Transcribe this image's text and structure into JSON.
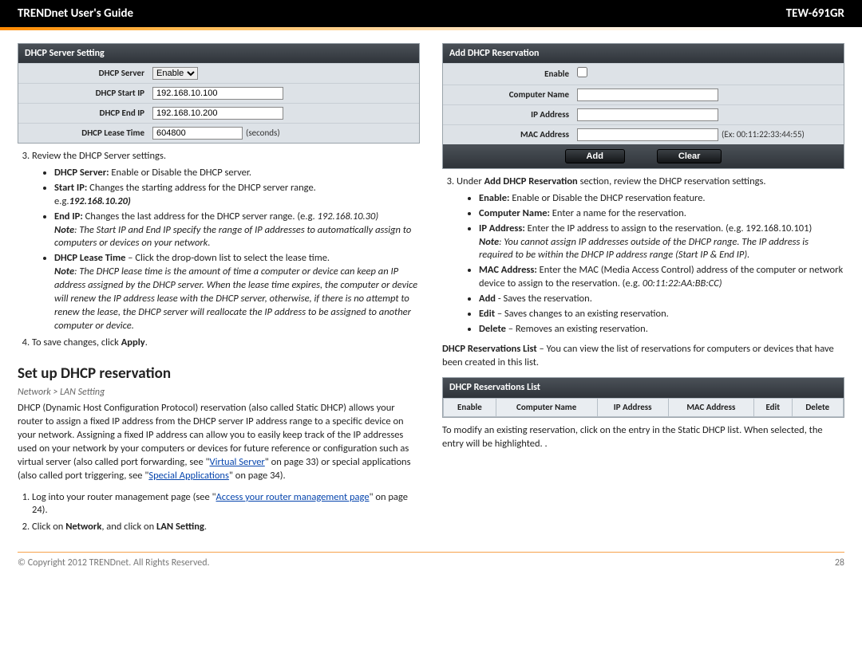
{
  "header": {
    "left": "TRENDnet User's Guide",
    "right": "TEW-691GR"
  },
  "dhcpServerPanel": {
    "title": "DHCP Server Setting",
    "rows": {
      "serverLabel": "DHCP Server",
      "serverValue": "Enable",
      "startLabel": "DHCP Start IP",
      "startValue": "192.168.10.100",
      "endLabel": "DHCP End IP",
      "endValue": "192.168.10.200",
      "leaseLabel": "DHCP Lease Time",
      "leaseValue": "604800",
      "leaseSuffix": "(seconds)"
    }
  },
  "reviewIntro": "Review the DHCP Server settings.",
  "reviewBullets": {
    "b1_label": "DHCP Server:",
    "b1_text": " Enable or Disable the DHCP server.",
    "b2_label": "Start IP:",
    "b2_text": " Changes the starting address for the DHCP server range.",
    "b2_eg_prefix": "e.g.",
    "b2_eg_value": "192.168.10.20)",
    "b3_label": "End IP:",
    "b3_text": " Changes the last address for the DHCP server range. (e.g. ",
    "b3_eg": "192.168.10.30)",
    "b3_note_label": "Note",
    "b3_note": ": The Start IP and End IP specify the range of IP addresses to automatically assign to computers or devices on your network.",
    "b4_label": "DHCP Lease Time",
    "b4_text": " – Click the drop-down list to select the lease time.",
    "b4_note_label": "Note",
    "b4_note": ": The DHCP lease time is the amount of time a computer or device can keep an IP address assigned by the DHCP server. When the lease time expires, the computer or device will renew the IP address lease with the DHCP server, otherwise, if there is no attempt to renew the lease, the DHCP server will reallocate the IP address to be assigned to another computer or device."
  },
  "save_prefix": "To save changes, click ",
  "save_bold": "Apply",
  "save_suffix": ".",
  "sectionTitle": "Set up DHCP reservation",
  "breadcrumb": "Network > LAN Setting",
  "resvIntro_a": "DHCP (Dynamic Host Configuration Protocol) reservation (also called Static DHCP) allows your router to assign a fixed IP address from the DHCP server IP address range to a specific device on your network. Assigning a fixed IP address can allow you to easily keep track of the IP addresses used on your network by your computers or devices for future reference or configuration such as virtual server (also called port forwarding, see \"",
  "resvIntro_link1": "Virtual Server",
  "resvIntro_b": "\" on page 33) or special applications (also called port triggering, see \"",
  "resvIntro_link2": "Special Applications",
  "resvIntro_c": "\" on page 34).",
  "steps": {
    "s1a": "Log into your router management page (see \"",
    "s1link": "Access your router management page",
    "s1b": "\" on page 24).",
    "s2a": "Click on ",
    "s2b": "Network",
    "s2c": ", and click on ",
    "s2d": "LAN Setting",
    "s2e": "."
  },
  "addPanel": {
    "title": "Add DHCP Reservation",
    "rows": {
      "enableLabel": "Enable",
      "nameLabel": "Computer Name",
      "ipLabel": "IP Address",
      "macLabel": "MAC Address",
      "macHint": "(Ex: 00:11:22:33:44:55)"
    },
    "btnAdd": "Add",
    "btnClear": "Clear"
  },
  "rightIntro_a": "Under ",
  "rightIntro_bold": "Add DHCP Reservation",
  "rightIntro_b": " section, review the DHCP reservation settings.",
  "rightBullets": {
    "r1_label": "Enable:",
    "r1_text": " Enable or Disable the DHCP reservation feature.",
    "r2_label": "Computer Name:",
    "r2_text": " Enter a name for the reservation.",
    "r3_label": "IP Address:",
    "r3_text": " Enter the IP address to assign to the reservation. (e.g. 192.168.10.101)",
    "r3_note_label": "Note",
    "r3_note": ": You cannot assign IP addresses outside of the DHCP range. The IP address is required to be within the DHCP IP address range (Start IP & End IP).",
    "r4_label": "MAC Address:",
    "r4_text": " Enter the MAC (Media Access Control) address of the computer or network device to assign to the reservation. (e.g. ",
    "r4_eg": "00:11:22:AA:BB:CC)",
    "r5_label": "Add",
    "r5_text": " - Saves the reservation.",
    "r6_label": "Edit",
    "r6_text": " – Saves changes to an existing reservation.",
    "r7_label": "Delete",
    "r7_text": " – Removes an existing reservation."
  },
  "resvListNote_label": "DHCP Reservations List",
  "resvListNote_text": " – You can view the list of reservations for computers or devices that have been created in this list.",
  "listPanel": {
    "title": "DHCP Reservations List",
    "cols": {
      "c1": "Enable",
      "c2": "Computer Name",
      "c3": "IP Address",
      "c4": "MAC Address",
      "c5": "Edit",
      "c6": "Delete"
    }
  },
  "modifyNote": "To modify an existing reservation, click on the entry in the Static DHCP list. When selected, the entry will be highlighted. .",
  "footer": {
    "copyright": "© Copyright 2012 TRENDnet. All Rights Reserved.",
    "page": "28"
  }
}
